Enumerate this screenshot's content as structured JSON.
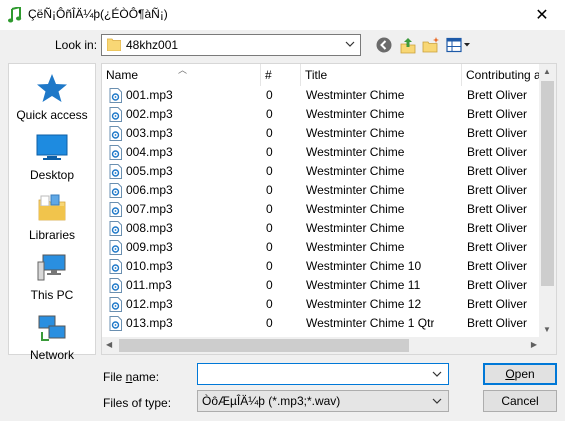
{
  "window": {
    "title": "ÇëÑ¡ÔñÎÄ¼þ(¿ÉÒÔ¶àÑ¡)",
    "close_glyph": "✕"
  },
  "lookin": {
    "label": "Look in:",
    "value": "48khz001"
  },
  "places": [
    {
      "label": "Quick access",
      "icon": "star-icon"
    },
    {
      "label": "Desktop",
      "icon": "desktop-icon"
    },
    {
      "label": "Libraries",
      "icon": "libraries-icon"
    },
    {
      "label": "This PC",
      "icon": "computer-icon"
    },
    {
      "label": "Network",
      "icon": "network-icon"
    }
  ],
  "columns": [
    "Name",
    "#",
    "Title",
    "Contributing a"
  ],
  "files": [
    {
      "name": "001.mp3",
      "num": "0",
      "title": "Westminter Chime",
      "artist": "Brett Oliver"
    },
    {
      "name": "002.mp3",
      "num": "0",
      "title": "Westminter Chime",
      "artist": "Brett Oliver"
    },
    {
      "name": "003.mp3",
      "num": "0",
      "title": "Westminter Chime",
      "artist": "Brett Oliver"
    },
    {
      "name": "004.mp3",
      "num": "0",
      "title": "Westminter Chime",
      "artist": "Brett Oliver"
    },
    {
      "name": "005.mp3",
      "num": "0",
      "title": "Westminter Chime",
      "artist": "Brett Oliver"
    },
    {
      "name": "006.mp3",
      "num": "0",
      "title": "Westminter Chime",
      "artist": "Brett Oliver"
    },
    {
      "name": "007.mp3",
      "num": "0",
      "title": "Westminter Chime",
      "artist": "Brett Oliver"
    },
    {
      "name": "008.mp3",
      "num": "0",
      "title": "Westminter Chime",
      "artist": "Brett Oliver"
    },
    {
      "name": "009.mp3",
      "num": "0",
      "title": "Westminter Chime",
      "artist": "Brett Oliver"
    },
    {
      "name": "010.mp3",
      "num": "0",
      "title": "Westminter Chime 10",
      "artist": "Brett Oliver"
    },
    {
      "name": "011.mp3",
      "num": "0",
      "title": "Westminter Chime 11",
      "artist": "Brett Oliver"
    },
    {
      "name": "012.mp3",
      "num": "0",
      "title": "Westminter Chime 12",
      "artist": "Brett Oliver"
    },
    {
      "name": "013.mp3",
      "num": "0",
      "title": "Westminter Chime 1 Qtr",
      "artist": "Brett Oliver"
    }
  ],
  "filename": {
    "label_pre": "File ",
    "label_ul": "n",
    "label_post": "ame:",
    "value": ""
  },
  "filetype": {
    "label": "Files of type:",
    "value": "ÒôÆµÎÄ¼þ (*.mp3;*.wav)"
  },
  "buttons": {
    "open_ul": "O",
    "open_rest": "pen",
    "cancel": "Cancel"
  },
  "colors": {
    "accent": "#0078d7",
    "folder": "#f8d775",
    "title_icon": "#2e9a2e"
  }
}
